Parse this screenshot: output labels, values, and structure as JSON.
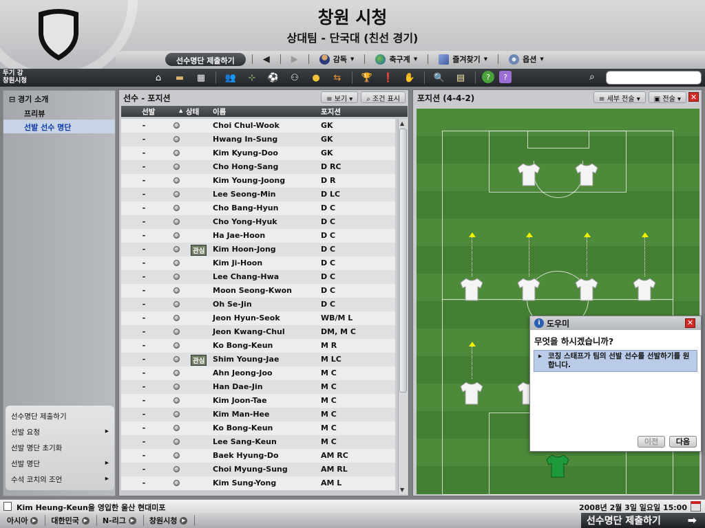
{
  "header": {
    "title": "창원 시청",
    "subtitle": "상대팀 - 단국대 (친선 경기)"
  },
  "topnav": {
    "submit_label": "선수명단 제출하기",
    "items": [
      {
        "label": "감독",
        "icon": "manager-icon"
      },
      {
        "label": "축구계",
        "icon": "globe-icon"
      },
      {
        "label": "즐겨찾기",
        "icon": "bookmark-icon"
      },
      {
        "label": "옵션",
        "icon": "gears-icon"
      }
    ]
  },
  "toolbar": {
    "team_line1": "두기 강",
    "team_line2": "창원시청",
    "search_placeholder": ""
  },
  "sidebar": {
    "header": "경기 소개",
    "items": [
      "프리뷰",
      "선발 선수 명단"
    ],
    "selected": "선발 선수 명단",
    "actions": [
      {
        "label": "선수명단 제출하기",
        "arrow": false
      },
      {
        "label": "선발 요청",
        "arrow": true
      },
      {
        "label": "선발 명단 초기화",
        "arrow": false
      },
      {
        "label": "선발 명단",
        "arrow": true
      },
      {
        "label": "수석 코치의 조언",
        "arrow": true
      }
    ]
  },
  "players_panel": {
    "title": "선수 - 포지션",
    "view_btn": "보기",
    "filter_btn": "조건 표시",
    "columns": [
      "선발",
      "상태",
      "이름",
      "포지션"
    ],
    "rows": [
      {
        "sel": "-",
        "badge": "",
        "name": "Choi Chul-Wook",
        "pos": "GK"
      },
      {
        "sel": "-",
        "badge": "",
        "name": "Hwang In-Sung",
        "pos": "GK"
      },
      {
        "sel": "-",
        "badge": "",
        "name": "Kim Kyung-Doo",
        "pos": "GK"
      },
      {
        "sel": "-",
        "badge": "",
        "name": "Cho Hong-Sang",
        "pos": "D RC"
      },
      {
        "sel": "-",
        "badge": "",
        "name": "Kim Young-Joong",
        "pos": "D R"
      },
      {
        "sel": "-",
        "badge": "",
        "name": "Lee Seong-Min",
        "pos": "D LC"
      },
      {
        "sel": "-",
        "badge": "",
        "name": "Cho Bang-Hyun",
        "pos": "D C"
      },
      {
        "sel": "-",
        "badge": "",
        "name": "Cho Yong-Hyuk",
        "pos": "D C"
      },
      {
        "sel": "-",
        "badge": "",
        "name": "Ha Jae-Hoon",
        "pos": "D C"
      },
      {
        "sel": "-",
        "badge": "관심",
        "name": "Kim Hoon-Jong",
        "pos": "D C"
      },
      {
        "sel": "-",
        "badge": "",
        "name": "Kim Ji-Hoon",
        "pos": "D C"
      },
      {
        "sel": "-",
        "badge": "",
        "name": "Lee Chang-Hwa",
        "pos": "D C"
      },
      {
        "sel": "-",
        "badge": "",
        "name": "Moon Seong-Kwon",
        "pos": "D C"
      },
      {
        "sel": "-",
        "badge": "",
        "name": "Oh Se-Jin",
        "pos": "D C"
      },
      {
        "sel": "-",
        "badge": "",
        "name": "Jeon Hyun-Seok",
        "pos": "WB/M L"
      },
      {
        "sel": "-",
        "badge": "",
        "name": "Jeon Kwang-Chul",
        "pos": "DM, M C"
      },
      {
        "sel": "-",
        "badge": "",
        "name": "Ko Bong-Keun",
        "pos": "M R"
      },
      {
        "sel": "-",
        "badge": "관심",
        "name": "Shim Young-Jae",
        "pos": "M LC"
      },
      {
        "sel": "-",
        "badge": "",
        "name": "Ahn Jeong-Joo",
        "pos": "M C"
      },
      {
        "sel": "-",
        "badge": "",
        "name": "Han Dae-Jin",
        "pos": "M C"
      },
      {
        "sel": "-",
        "badge": "",
        "name": "Kim Joon-Tae",
        "pos": "M C"
      },
      {
        "sel": "-",
        "badge": "",
        "name": "Kim Man-Hee",
        "pos": "M C"
      },
      {
        "sel": "-",
        "badge": "",
        "name": "Ko Bong-Keun",
        "pos": "M C"
      },
      {
        "sel": "-",
        "badge": "",
        "name": "Lee Sang-Keun",
        "pos": "M C"
      },
      {
        "sel": "-",
        "badge": "",
        "name": "Baek Hyung-Do",
        "pos": "AM RC"
      },
      {
        "sel": "-",
        "badge": "",
        "name": "Choi Myung-Sung",
        "pos": "AM RL"
      },
      {
        "sel": "-",
        "badge": "",
        "name": "Kim Sung-Yong",
        "pos": "AM L"
      }
    ]
  },
  "pitch_panel": {
    "title": "포지션 (4-4-2)",
    "detail_btn": "세부 전술",
    "tactics_btn": "전술"
  },
  "dialog": {
    "title": "도우미",
    "question": "무엇을 하시겠습니까?",
    "option": "코칭 스태프가 팀의 선발 선수를 선발하기를 원합니다.",
    "prev": "이전",
    "next": "다음"
  },
  "status": {
    "news": "Kim Heung-Keun을 영입한 울산 현대미포",
    "datetime": "2008년 2월 3일 일요일 15:00"
  },
  "breadcrumbs": [
    "아시아",
    "대한민국",
    "N-리그",
    "창원시청"
  ],
  "submit_button": "선수명단 제출하기",
  "colors": {
    "pitch": "#4d8a3a",
    "selected_text": "#0b3aa8",
    "close": "#cf2a26"
  }
}
